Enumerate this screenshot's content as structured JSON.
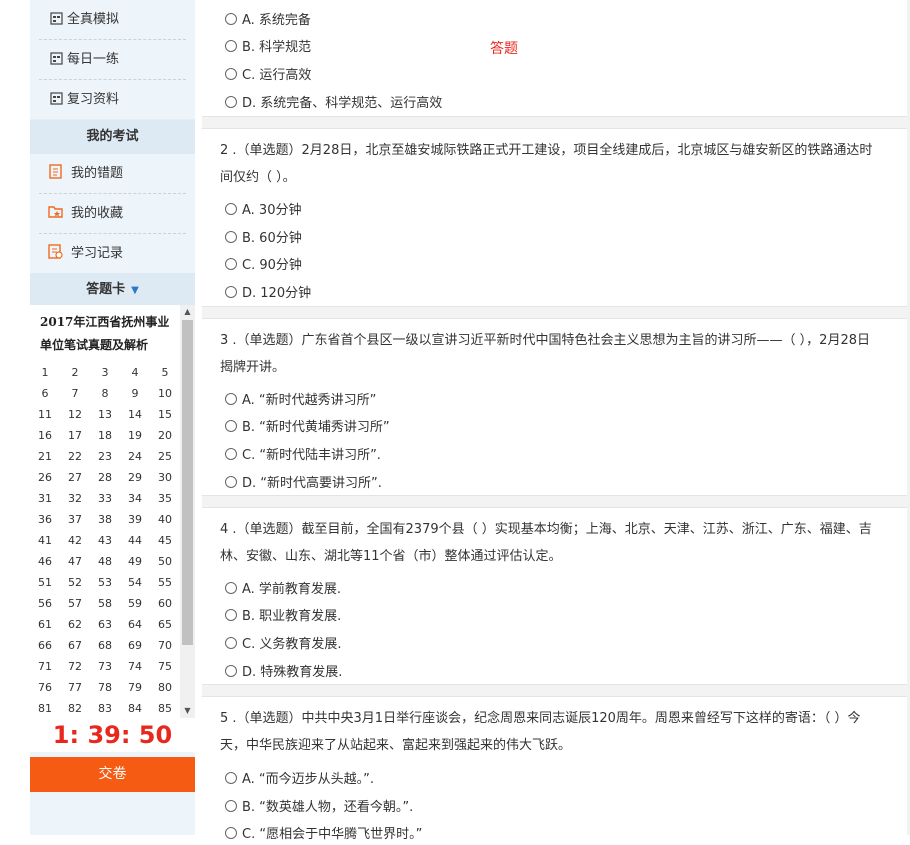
{
  "sidebar": {
    "nav_top": [
      {
        "label": "全真模拟"
      },
      {
        "label": "每日一练"
      },
      {
        "label": "复习资料"
      }
    ],
    "my_exam_header": "我的考试",
    "nav_exam": [
      {
        "label": "我的错题"
      },
      {
        "label": "我的收藏"
      },
      {
        "label": "学习记录"
      }
    ],
    "card_header": "答题卡",
    "exam_title": "2017年江西省抚州事业单位笔试真题及解析",
    "numbers": [
      "1",
      "2",
      "3",
      "4",
      "5",
      "6",
      "7",
      "8",
      "9",
      "10",
      "11",
      "12",
      "13",
      "14",
      "15",
      "16",
      "17",
      "18",
      "19",
      "20",
      "21",
      "22",
      "23",
      "24",
      "25",
      "26",
      "27",
      "28",
      "29",
      "30",
      "31",
      "32",
      "33",
      "34",
      "35",
      "36",
      "37",
      "38",
      "39",
      "40",
      "41",
      "42",
      "43",
      "44",
      "45",
      "46",
      "47",
      "48",
      "49",
      "50",
      "51",
      "52",
      "53",
      "54",
      "55",
      "56",
      "57",
      "58",
      "59",
      "60",
      "61",
      "62",
      "63",
      "64",
      "65",
      "66",
      "67",
      "68",
      "69",
      "70",
      "71",
      "72",
      "73",
      "74",
      "75",
      "76",
      "77",
      "78",
      "79",
      "80",
      "81",
      "82",
      "83",
      "84",
      "85"
    ],
    "timer": "1: 39: 50",
    "submit_label": "交卷"
  },
  "answer_link": "答题",
  "questions": [
    {
      "stem": "",
      "options": [
        "A. 系统完备",
        "B. 科学规范",
        "C. 运行高效",
        "D. 系统完备、科学规范、运行高效"
      ]
    },
    {
      "stem": "2 .（单选题）2月28日，北京至雄安城际铁路正式开工建设，项目全线建成后，北京城区与雄安新区的铁路通达时间仅约（ ）。",
      "options": [
        "A. 30分钟",
        "B. 60分钟",
        "C. 90分钟",
        "D. 120分钟"
      ]
    },
    {
      "stem": "3 .（单选题）广东省首个县区一级以宣讲习近平新时代中国特色社会主义思想为主旨的讲习所——（ ），2月28日揭牌开讲。",
      "options": [
        "A. “新时代越秀讲习所”",
        "B. “新时代黄埔秀讲习所”",
        "C. “新时代陆丰讲习所”.",
        "D. “新时代高要讲习所”."
      ]
    },
    {
      "stem": "4 .（单选题）截至目前，全国有2379个县（ ）实现基本均衡；上海、北京、天津、江苏、浙江、广东、福建、吉林、安徽、山东、湖北等11个省（市）整体通过评估认定。",
      "options": [
        "A. 学前教育发展.",
        "B. 职业教育发展.",
        "C. 义务教育发展.",
        "D. 特殊教育发展."
      ]
    },
    {
      "stem": "5 .（单选题）中共中央3月1日举行座谈会，纪念周恩来同志诞辰120周年。周恩来曾经写下这样的寄语：（ ）今天，中华民族迎来了从站起来、富起来到强起来的伟大飞跃。",
      "options": [
        "A. “而今迈步从头越。”.",
        "B. “数英雄人物，还看今朝。”.",
        "C. “愿相会于中华腾飞世界时。”"
      ]
    }
  ],
  "colors": {
    "accent_red": "#e8281d",
    "submit_orange": "#f55b12",
    "sidebar_bg": "#edf4fa",
    "header_bg": "#dde9f3"
  },
  "icons": [
    "calendar-icon",
    "error-book-icon",
    "favorites-icon",
    "study-record-icon",
    "caret-down-icon",
    "radio-icon"
  ]
}
